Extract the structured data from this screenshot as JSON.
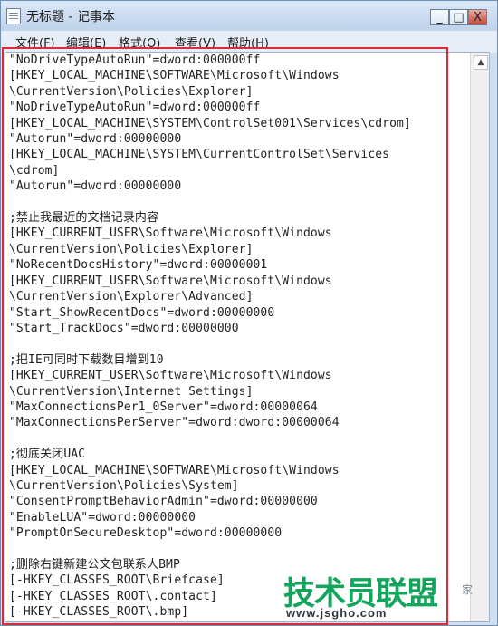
{
  "window": {
    "title": "无标题 - 记事本",
    "minimize_label": "_",
    "maximize_label": "□",
    "close_label": "X"
  },
  "menubar": {
    "items": [
      {
        "label": "文件(F)"
      },
      {
        "label": "编辑(E)"
      },
      {
        "label": "格式(O)"
      },
      {
        "label": "查看(V)"
      },
      {
        "label": "帮助(H)"
      }
    ]
  },
  "editor": {
    "text": "\"NoDriveTypeAutoRun\"=dword:000000ff\n[HKEY_LOCAL_MACHINE\\SOFTWARE\\Microsoft\\Windows\n\\CurrentVersion\\Policies\\Explorer]\n\"NoDriveTypeAutoRun\"=dword:000000ff\n[HKEY_LOCAL_MACHINE\\SYSTEM\\ControlSet001\\Services\\cdrom]\n\"Autorun\"=dword:00000000\n[HKEY_LOCAL_MACHINE\\SYSTEM\\CurrentControlSet\\Services\n\\cdrom]\n\"Autorun\"=dword:00000000\n\n;禁止我最近的文档记录内容\n[HKEY_CURRENT_USER\\Software\\Microsoft\\Windows\n\\CurrentVersion\\Policies\\Explorer]\n\"NoRecentDocsHistory\"=dword:00000001\n[HKEY_CURRENT_USER\\Software\\Microsoft\\Windows\n\\CurrentVersion\\Explorer\\Advanced]\n\"Start_ShowRecentDocs\"=dword:00000000\n\"Start_TrackDocs\"=dword:00000000\n\n;把IE可同时下载数目增到10\n[HKEY_CURRENT_USER\\Software\\Microsoft\\Windows\n\\CurrentVersion\\Internet Settings]\n\"MaxConnectionsPer1_0Server\"=dword:00000064\n\"MaxConnectionsPerServer\"=dword:dword:00000064\n\n;彻底关闭UAC\n[HKEY_LOCAL_MACHINE\\SOFTWARE\\Microsoft\\Windows\n\\CurrentVersion\\Policies\\System]\n\"ConsentPromptBehaviorAdmin\"=dword:00000000\n\"EnableLUA\"=dword:00000000\n\"PromptOnSecureDesktop\"=dword:00000000\n\n;删除右键新建公文包联系人BMP\n[-HKEY_CLASSES_ROOT\\Briefcase]\n[-HKEY_CLASSES_ROOT\\.contact]\n[-HKEY_CLASSES_ROOT\\.bmp]"
  },
  "watermark": {
    "main": "技术员联盟",
    "sub": "www.jsgho.com",
    "side": "家"
  },
  "colors": {
    "highlight_border": "#d92b35",
    "watermark_green": "#12a55b"
  }
}
